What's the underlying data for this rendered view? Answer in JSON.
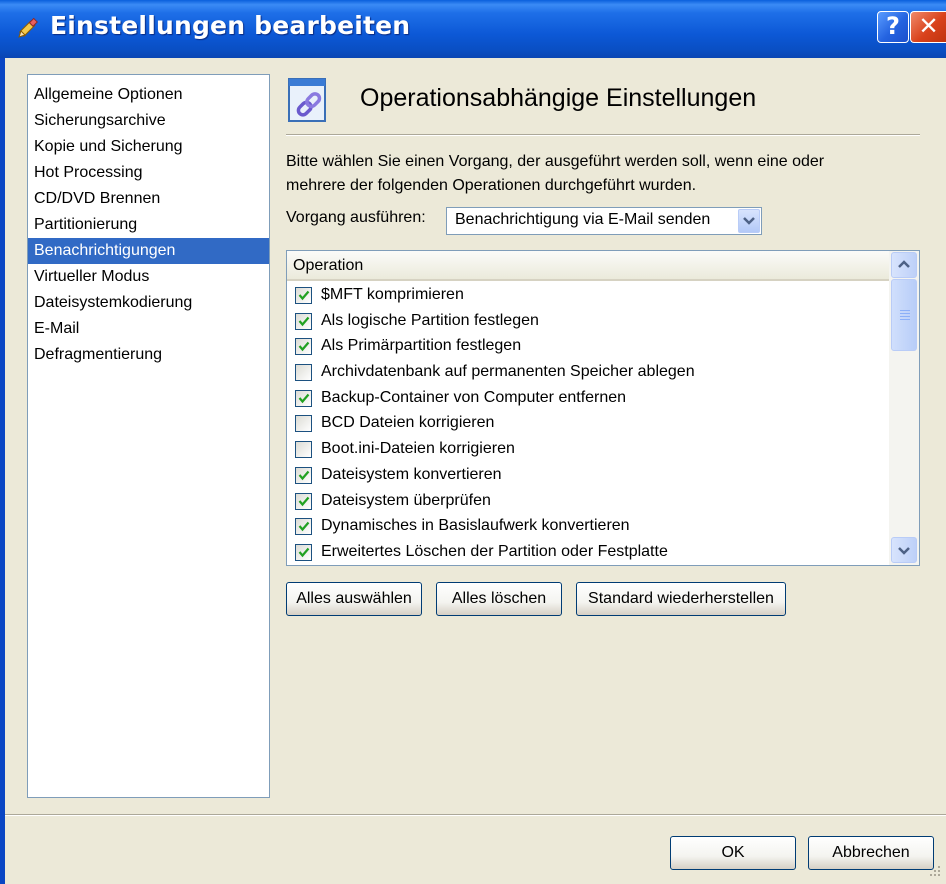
{
  "window": {
    "title": "Einstellungen bearbeiten",
    "help_label": "?",
    "close_label": "✕"
  },
  "sidebar": {
    "items": [
      {
        "label": "Allgemeine Optionen"
      },
      {
        "label": "Sicherungsarchive"
      },
      {
        "label": "Kopie und Sicherung"
      },
      {
        "label": "Hot Processing"
      },
      {
        "label": "CD/DVD Brennen"
      },
      {
        "label": "Partitionierung"
      },
      {
        "label": "Benachrichtigungen",
        "selected": true
      },
      {
        "label": "Virtueller Modus"
      },
      {
        "label": "Dateisystemkodierung"
      },
      {
        "label": "E-Mail"
      },
      {
        "label": "Defragmentierung"
      }
    ]
  },
  "main": {
    "title": "Operationsabhängige Einstellungen",
    "description_line1": "Bitte wählen Sie einen Vorgang, der ausgeführt werden soll, wenn eine oder",
    "description_line2": "mehrere der folgenden Operationen durchgeführt wurden.",
    "action_label": "Vorgang ausführen:",
    "action_value": "Benachrichtigung via E-Mail senden",
    "list_header": "Operation",
    "operations": [
      {
        "label": "$MFT komprimieren",
        "checked": true
      },
      {
        "label": "Als logische Partition festlegen",
        "checked": true
      },
      {
        "label": "Als Primärpartition festlegen",
        "checked": true
      },
      {
        "label": "Archivdatenbank auf permanenten Speicher ablegen",
        "checked": false
      },
      {
        "label": "Backup-Container von Computer entfernen",
        "checked": true
      },
      {
        "label": "BCD Dateien korrigieren",
        "checked": false
      },
      {
        "label": "Boot.ini-Dateien korrigieren",
        "checked": false
      },
      {
        "label": "Dateisystem konvertieren",
        "checked": true
      },
      {
        "label": "Dateisystem überprüfen",
        "checked": true
      },
      {
        "label": "Dynamisches in Basislaufwerk konvertieren",
        "checked": true
      },
      {
        "label": "Erweitertes Löschen der Partition oder Festplatte",
        "checked": true
      }
    ],
    "select_all_label": "Alles auswählen",
    "clear_all_label": "Alles löschen",
    "restore_defaults_label": "Standard wiederherstellen"
  },
  "footer": {
    "ok_label": "OK",
    "cancel_label": "Abbrechen"
  },
  "colors": {
    "titlebar": "#0a5fdc",
    "selection": "#316ac5",
    "dialog_bg": "#ece9d8"
  }
}
